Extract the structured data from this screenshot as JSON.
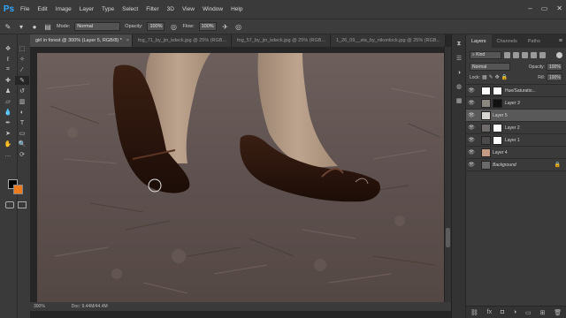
{
  "app": {
    "logo": "Ps"
  },
  "menu": [
    "File",
    "Edit",
    "Image",
    "Layer",
    "Type",
    "Select",
    "Filter",
    "3D",
    "View",
    "Window",
    "Help"
  ],
  "window_controls": [
    "–",
    "▭",
    "✕"
  ],
  "options": {
    "mode_label": "Mode:",
    "mode_value": "Normal",
    "opacity_label": "Opacity:",
    "opacity_value": "100%",
    "flow_label": "Flow:",
    "flow_value": "100%"
  },
  "tabs": [
    {
      "label": "girl in forest @ 300% (Layer 5, RGB/8) *",
      "close": "×"
    },
    {
      "label": "fog_71_by_jin_kdeck.jpg @ 25% (RGB...",
      "close": "×"
    },
    {
      "label": "fog_57_by_jin_kdeck.jpg @ 25% (RGB...",
      "close": "×"
    },
    {
      "label": "1_26_09__sta_by_nikonlock.jpg @ 25% (RGB...",
      "close": "×"
    }
  ],
  "status": {
    "zoom": "300%",
    "doc": "Doc: 9.44M/44.4M"
  },
  "layers_panel": {
    "tabs": [
      "Layers",
      "Channels",
      "Paths"
    ],
    "kind_label": "Kind",
    "blend_mode": "Normal",
    "opacity_label": "Opacity:",
    "opacity_value": "100%",
    "lock_label": "Lock:",
    "fill_label": "Fill:",
    "fill_value": "100%",
    "layers": [
      {
        "name": "Hue/Saturatio...",
        "italic": false,
        "thumb": "#ffffff",
        "mask": "#ffffff",
        "selected": false
      },
      {
        "name": "Layer 3",
        "italic": true,
        "thumb": "#8b8680",
        "mask": "#111111",
        "selected": false
      },
      {
        "name": "Layer 5",
        "italic": false,
        "thumb": "#d8d4d0",
        "mask": "",
        "selected": true
      },
      {
        "name": "Layer 2",
        "italic": false,
        "thumb": "#6f6b6a",
        "mask": "#ffffff",
        "selected": false
      },
      {
        "name": "Layer 1",
        "italic": false,
        "thumb": "#4c4a4a",
        "mask": "#ffffff",
        "selected": false
      },
      {
        "name": "Layer 4",
        "italic": false,
        "thumb": "#c49a85",
        "mask": "",
        "selected": false
      },
      {
        "name": "Background",
        "italic": true,
        "thumb": "#6a6a6a",
        "mask": "",
        "selected": false
      }
    ]
  },
  "colors": {
    "foreground": "#000000",
    "background": "#ee7a1e",
    "accent": "#31a8ff"
  }
}
